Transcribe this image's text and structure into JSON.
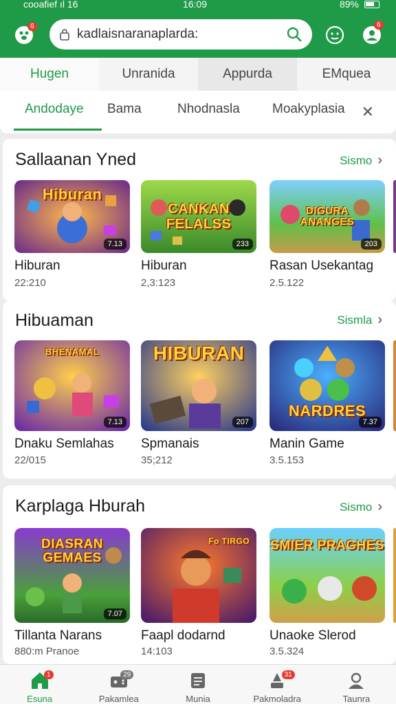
{
  "status_bar": {
    "left": "cooafief ıl 16",
    "time": "16:09",
    "battery": "89%"
  },
  "header": {
    "search_text": "kadlaisnaranaplarda:",
    "left_badge": "6",
    "right_badge": "6"
  },
  "top_tabs": [
    "Hugen",
    "Unranida",
    "Appurda",
    "EMquea"
  ],
  "filter_chips": [
    "Andodaye",
    "Bama",
    "Nhodnasla",
    "Moakyplasia"
  ],
  "sections": [
    {
      "title": "Sallaanan Yned",
      "see_more": "Sismo",
      "cards": [
        {
          "art": "Hiburan",
          "rating": "7.13",
          "title": "Hiburan",
          "sub": "22:210"
        },
        {
          "art": "CANKAN FELALSS",
          "rating": "233",
          "title": "Hiburan",
          "sub": "2,3:123"
        },
        {
          "art": "DIGURA ANANGES",
          "rating": "203",
          "title": "Rasan Usekantag",
          "sub": "2.5.122"
        }
      ]
    },
    {
      "title": "Hibuaman",
      "see_more": "Sismla",
      "cards": [
        {
          "art": "BHENAMAL",
          "rating": "7.13",
          "title": "Dnaku Semlahas",
          "sub": "22/015"
        },
        {
          "art": "HIBURAN",
          "rating": "207",
          "title": "Spmanais",
          "sub": "35;212"
        },
        {
          "art": "NARDRES",
          "rating": "7.37",
          "title": "Manin Game",
          "sub": "3.5.153"
        }
      ]
    },
    {
      "title": "Karplaga Hburah",
      "see_more": "Sismo",
      "cards": [
        {
          "art": "DIASRAN GEMAES",
          "rating": "7.07",
          "title": "Tillanta Narans",
          "sub": "880:m Pranoe"
        },
        {
          "art": "Fo TIRGO",
          "rating": "",
          "title": "Faapl dodarnd",
          "sub": "14:103"
        },
        {
          "art": "SMIER PRAGHES",
          "rating": "",
          "title": "Unaoke Slerod",
          "sub": "3.5.324"
        }
      ]
    }
  ],
  "bottom_nav": [
    {
      "label": "Esuna",
      "badge": "1",
      "icon": "home-icon"
    },
    {
      "label": "Pakamlea",
      "badge": "29",
      "icon": "games-icon"
    },
    {
      "label": "Munia",
      "badge": "",
      "icon": "apps-icon"
    },
    {
      "label": "Pakmoladra",
      "badge": "31",
      "icon": "updates-icon"
    },
    {
      "label": "Taunra",
      "badge": "",
      "icon": "profile-icon"
    }
  ],
  "colors": {
    "brand": "#1f9a48",
    "badge": "#e63a2e"
  }
}
